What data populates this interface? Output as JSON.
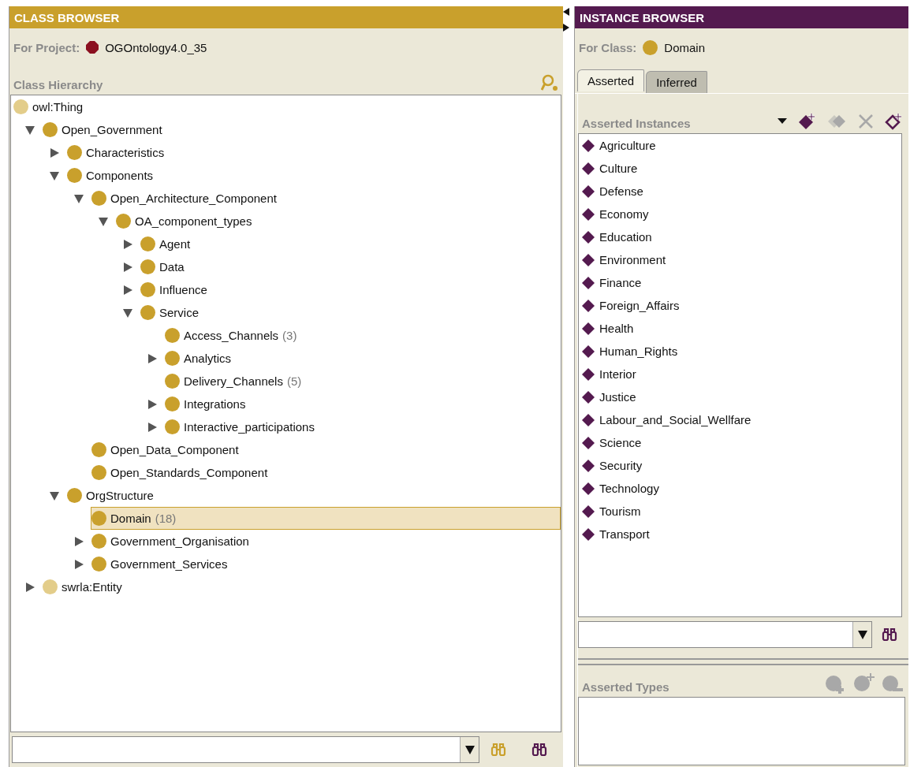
{
  "class_browser": {
    "title": "CLASS BROWSER",
    "project_label": "For Project:",
    "project_name": "OGOntology4.0_35",
    "hierarchy_label": "Class Hierarchy",
    "root": {
      "label": "owl:Thing",
      "kind": "builtin"
    },
    "tree": [
      {
        "label": "Open_Government",
        "kind": "class",
        "expanded": true,
        "selected": false,
        "children": [
          {
            "label": "Characteristics",
            "kind": "class",
            "expanded": false,
            "selected": false
          },
          {
            "label": "Components",
            "kind": "class",
            "expanded": true,
            "selected": false,
            "children": [
              {
                "label": "Open_Architecture_Component",
                "kind": "class",
                "expanded": true,
                "selected": false,
                "children": [
                  {
                    "label": "OA_component_types",
                    "kind": "class",
                    "expanded": true,
                    "selected": false,
                    "children": [
                      {
                        "label": "Agent",
                        "kind": "class",
                        "expanded": false,
                        "selected": false
                      },
                      {
                        "label": "Data",
                        "kind": "class",
                        "expanded": false,
                        "selected": false
                      },
                      {
                        "label": "Influence",
                        "kind": "class",
                        "expanded": false,
                        "selected": false
                      },
                      {
                        "label": "Service",
                        "kind": "class",
                        "expanded": true,
                        "selected": false,
                        "children": [
                          {
                            "label": "Access_Channels",
                            "count": "(3)",
                            "kind": "class",
                            "selected": false
                          },
                          {
                            "label": "Analytics",
                            "kind": "class",
                            "expanded": false,
                            "selected": false
                          },
                          {
                            "label": "Delivery_Channels",
                            "count": "(5)",
                            "kind": "class",
                            "selected": false
                          },
                          {
                            "label": "Integrations",
                            "kind": "class",
                            "expanded": false,
                            "selected": false
                          },
                          {
                            "label": "Interactive_participations",
                            "kind": "class",
                            "expanded": false,
                            "selected": false
                          }
                        ]
                      }
                    ]
                  }
                ]
              },
              {
                "label": "Open_Data_Component",
                "kind": "class",
                "selected": false
              },
              {
                "label": "Open_Standards_Component",
                "kind": "class",
                "selected": false
              }
            ]
          },
          {
            "label": "OrgStructure",
            "kind": "class",
            "expanded": true,
            "selected": false,
            "children": [
              {
                "label": "Domain",
                "count": "(18)",
                "kind": "class",
                "selected": true
              },
              {
                "label": "Government_Organisation",
                "kind": "class",
                "expanded": false,
                "selected": false
              },
              {
                "label": "Government_Services",
                "kind": "class",
                "expanded": false,
                "selected": false
              }
            ]
          }
        ]
      },
      {
        "label": "swrla:Entity",
        "kind": "builtin",
        "expanded": false,
        "selected": false
      }
    ]
  },
  "instance_browser": {
    "title": "INSTANCE BROWSER",
    "class_label": "For Class:",
    "class_name": "Domain",
    "tabs": [
      {
        "label": "Asserted",
        "selected": true
      },
      {
        "label": "Inferred",
        "selected": false
      }
    ],
    "instances_label": "Asserted Instances",
    "toolbar": [
      {
        "kind": "menu",
        "disabled": false
      },
      {
        "kind": "create",
        "disabled": false
      },
      {
        "kind": "copy",
        "disabled": true
      },
      {
        "kind": "delete",
        "disabled": true
      },
      {
        "kind": "edit",
        "disabled": false
      }
    ],
    "instances": [
      "Agriculture",
      "Culture",
      "Defense",
      "Economy",
      "Education",
      "Environment",
      "Finance",
      "Foreign_Affairs",
      "Health",
      "Human_Rights",
      "Interior",
      "Justice",
      "Labour_and_Social_Wellfare",
      "Science",
      "Security",
      "Technology",
      "Tourism",
      "Transport"
    ],
    "types_label": "Asserted Types"
  }
}
